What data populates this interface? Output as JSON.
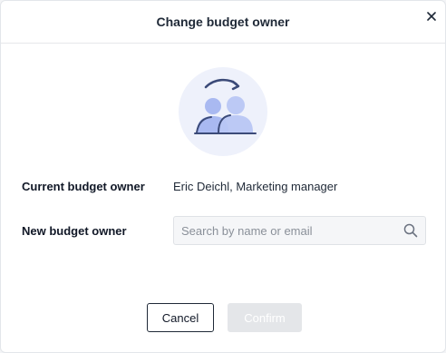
{
  "dialog": {
    "title": "Change budget owner",
    "close_icon": "close-icon"
  },
  "illustration": {
    "icon": "swap-people-icon"
  },
  "current_owner": {
    "label": "Current budget owner",
    "value": "Eric Deichl, Marketing manager"
  },
  "new_owner": {
    "label": "New budget owner",
    "search_placeholder": "Search by name or email",
    "search_value": "",
    "search_icon": "search-icon"
  },
  "actions": {
    "cancel_label": "Cancel",
    "confirm_label": "Confirm",
    "confirm_disabled": true
  },
  "colors": {
    "illustration_bg": "#eef1fb",
    "person_fill": "#a9b9f1",
    "person_stroke": "#3b4a78",
    "confirm_bg": "#e4e6e9"
  }
}
